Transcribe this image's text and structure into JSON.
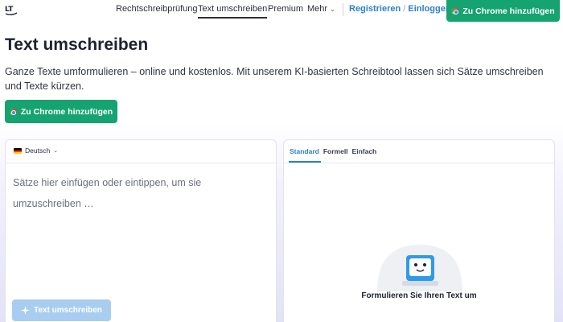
{
  "nav": {
    "logo_text": "LT",
    "items": [
      {
        "label": "Rechtschreibprüfung"
      },
      {
        "label": "Text umschreiben"
      },
      {
        "label": "Premium"
      },
      {
        "label": "Mehr"
      }
    ],
    "register": "Registrieren",
    "slash": "/",
    "login": "Einloggen",
    "cta": "Zu Chrome hinzufügen"
  },
  "page": {
    "title": "Text umschreiben",
    "intro": "Ganze Texte umformulieren – online und kostenlos. Mit unserem KI-basierten Schreibtool lassen sich Sätze umschreiben und Texte kürzen.",
    "cta": "Zu Chrome hinzufügen"
  },
  "editor": {
    "language": "Deutsch",
    "placeholder": "Sätze hier einfügen oder eintippen, um sie umzuschreiben …",
    "submit": "Text umschreiben"
  },
  "result": {
    "tabs": [
      {
        "label": "Standard",
        "active": true
      },
      {
        "label": "Formell",
        "active": false
      },
      {
        "label": "Einfach",
        "active": false
      }
    ],
    "empty_title": "Formulieren Sie Ihren Text um"
  },
  "colors": {
    "brand_green": "#15a371",
    "accent_blue": "#2b7fd4",
    "disabled_blue": "#a8cdf1"
  }
}
